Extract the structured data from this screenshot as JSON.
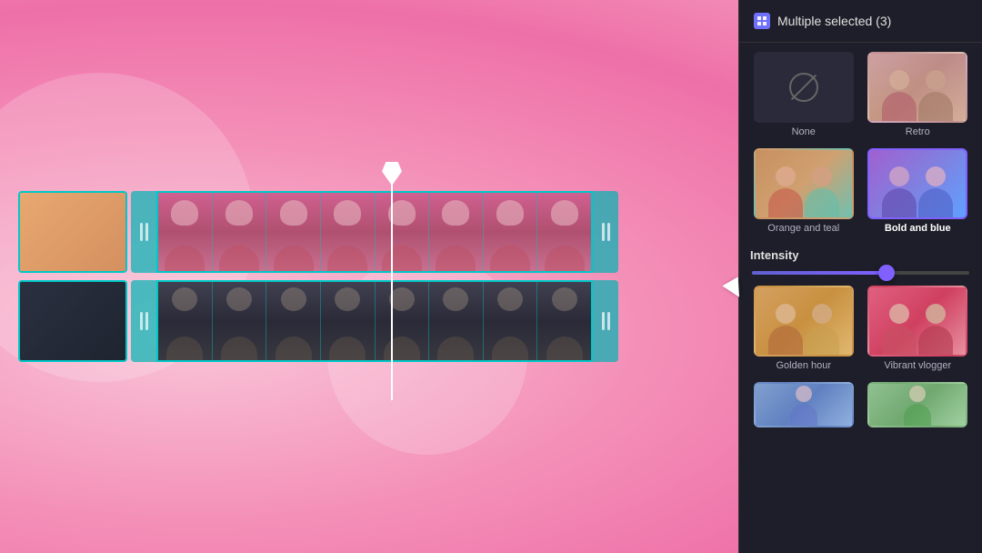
{
  "background": {
    "color": "#f5a0c0"
  },
  "panel": {
    "title": "Multiple selected (3)",
    "icon_label": "FX",
    "filters": [
      {
        "id": "none",
        "label": "None",
        "selected": false,
        "type": "none"
      },
      {
        "id": "retro",
        "label": "Retro",
        "selected": false,
        "type": "retro"
      },
      {
        "id": "orange-teal",
        "label": "Orange and teal",
        "selected": false,
        "type": "orange-teal"
      },
      {
        "id": "bold-blue",
        "label": "Bold and blue",
        "selected": true,
        "type": "bold-blue"
      },
      {
        "id": "golden-hour",
        "label": "Golden hour",
        "selected": false,
        "type": "golden"
      },
      {
        "id": "vibrant-vlogger",
        "label": "Vibrant vlogger",
        "selected": false,
        "type": "vibrant"
      },
      {
        "id": "more1",
        "label": "",
        "selected": false,
        "type": "more1"
      },
      {
        "id": "more2",
        "label": "",
        "selected": false,
        "type": "more2"
      }
    ],
    "intensity": {
      "label": "Intensity",
      "value": 62
    }
  },
  "timeline": {
    "track1_type": "video",
    "track2_type": "video"
  }
}
